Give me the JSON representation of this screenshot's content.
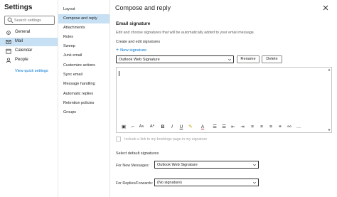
{
  "settings": {
    "title": "Settings",
    "search_placeholder": "Search settings",
    "categories": [
      {
        "label": "General",
        "icon": "gear-icon"
      },
      {
        "label": "Mail",
        "icon": "mail-icon"
      },
      {
        "label": "Calendar",
        "icon": "calendar-icon"
      },
      {
        "label": "People",
        "icon": "people-icon"
      }
    ],
    "view_quick": "View quick settings"
  },
  "subnav": {
    "items": [
      {
        "label": "Layout"
      },
      {
        "label": "Compose and reply"
      },
      {
        "label": "Attachments"
      },
      {
        "label": "Rules"
      },
      {
        "label": "Sweep"
      },
      {
        "label": "Junk email"
      },
      {
        "label": "Customize actions"
      },
      {
        "label": "Sync email"
      },
      {
        "label": "Message handling"
      },
      {
        "label": "Automatic replies"
      },
      {
        "label": "Retention policies"
      },
      {
        "label": "Groups"
      }
    ]
  },
  "panel": {
    "title": "Compose and reply",
    "email_signature_heading": "Email signature",
    "description": "Edit and choose signatures that will be automatically added to your email message.",
    "create_edit_label": "Create and edit signatures",
    "new_signature": "New signature",
    "selected_signature": "Outlook Web Signature",
    "rename_label": "Rename",
    "delete_label": "Delete",
    "toolbar_icons": [
      "image-icon",
      "paint-icon",
      "font-size-icon",
      "text-size-icon",
      "bold-icon",
      "italic-icon",
      "underline-icon",
      "highlight-icon",
      "font-color-icon",
      "bullets-icon",
      "numbering-icon",
      "decrease-indent-icon",
      "increase-indent-icon",
      "align-left-icon",
      "align-center-icon",
      "align-right-icon",
      "link-icon",
      "unlink-icon",
      "more-icon"
    ],
    "bookings_checkbox_label": "Include a link to my bookings page in my signature",
    "default_signatures_heading": "Select default signatures",
    "new_messages_label": "For New Messages:",
    "new_messages_value": "Outlook Web Signature",
    "replies_label": "For Replies/Forwards:",
    "replies_value": "(No signature)"
  },
  "colors": {
    "accent": "#0078d4",
    "selection": "#c7e0f4"
  }
}
